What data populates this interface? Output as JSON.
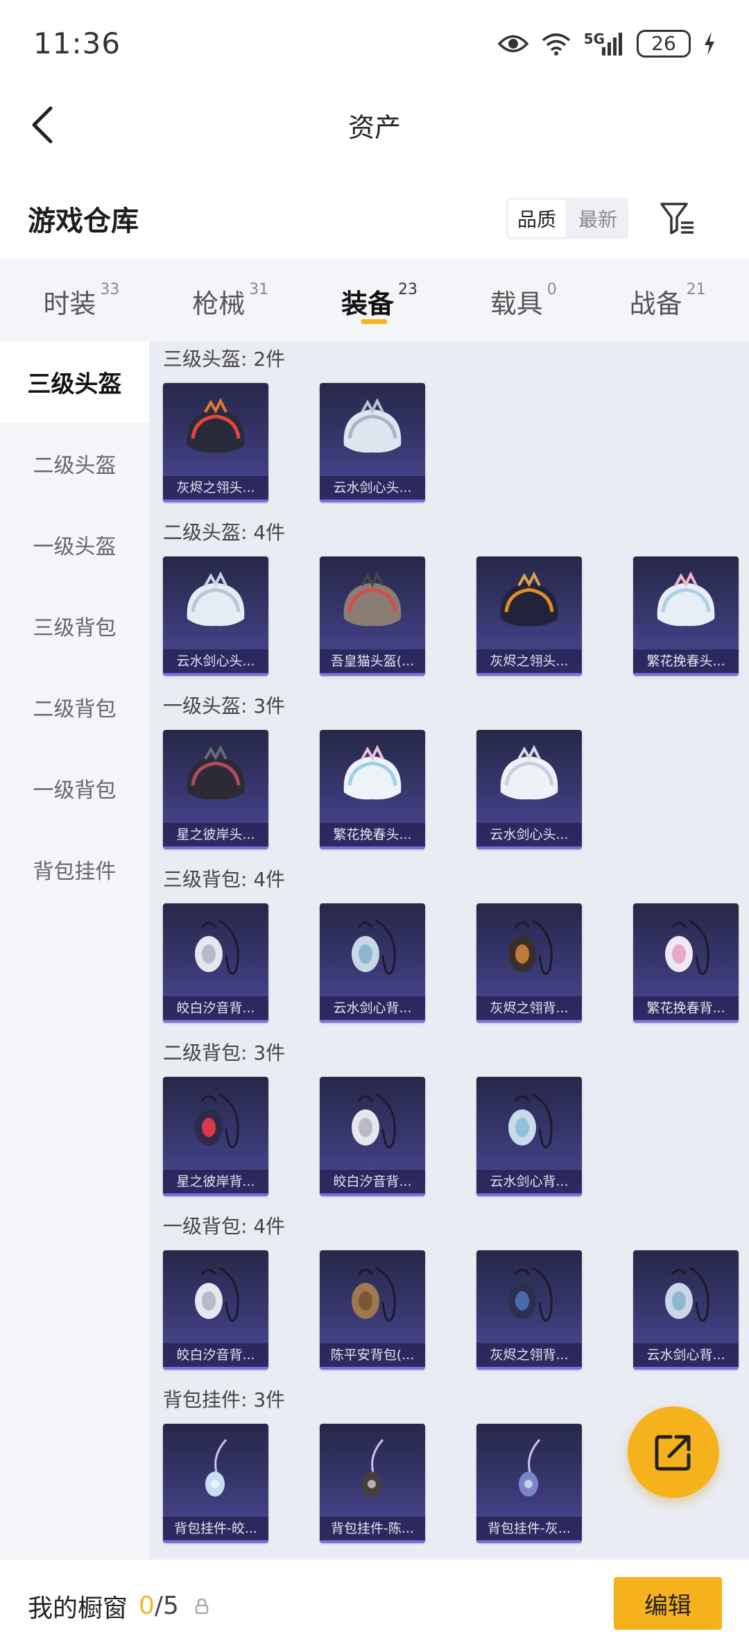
{
  "status_bar": {
    "time": "11:36",
    "network_label": "5G",
    "battery": "26",
    "icons": [
      "eye-icon",
      "wifi-icon",
      "signal-icon",
      "battery-icon",
      "charging-icon"
    ]
  },
  "header": {
    "title": "资产",
    "back_icon": "chevron-left-icon"
  },
  "warehouse": {
    "title": "游戏仓库",
    "sort_options": [
      "品质",
      "最新"
    ],
    "sort_selected": "品质",
    "filter_icon": "filter-icon"
  },
  "tabs": [
    {
      "label": "时装",
      "count": "33",
      "active": false
    },
    {
      "label": "枪械",
      "count": "31",
      "active": false
    },
    {
      "label": "装备",
      "count": "23",
      "active": true
    },
    {
      "label": "载具",
      "count": "0",
      "active": false
    },
    {
      "label": "战备",
      "count": "21",
      "active": false
    }
  ],
  "sidebar": {
    "items": [
      {
        "label": "三级头盔",
        "active": true
      },
      {
        "label": "二级头盔",
        "active": false
      },
      {
        "label": "一级头盔",
        "active": false
      },
      {
        "label": "三级背包",
        "active": false
      },
      {
        "label": "二级背包",
        "active": false
      },
      {
        "label": "一级背包",
        "active": false
      },
      {
        "label": "背包挂件",
        "active": false
      }
    ]
  },
  "sections": [
    {
      "title": "三级头盔: 2件",
      "items": [
        "灰烬之翎头...",
        "云水剑心头..."
      ]
    },
    {
      "title": "二级头盔: 4件",
      "items": [
        "云水剑心头...",
        "吾皇猫头盔(...",
        "灰烬之翎头...",
        "繁花挽春头..."
      ]
    },
    {
      "title": "一级头盔: 3件",
      "items": [
        "星之彼岸头...",
        "繁花挽春头...",
        "云水剑心头..."
      ]
    },
    {
      "title": "三级背包: 4件",
      "items": [
        "皎白汐音背...",
        "云水剑心背...",
        "灰烬之翎背...",
        "繁花挽春背..."
      ]
    },
    {
      "title": "二级背包: 3件",
      "items": [
        "星之彼岸背...",
        "皎白汐音背...",
        "云水剑心背..."
      ]
    },
    {
      "title": "一级背包: 4件",
      "items": [
        "皎白汐音背...",
        "陈平安背包(...",
        "灰烬之翎背...",
        "云水剑心背..."
      ]
    },
    {
      "title": "背包挂件: 3件",
      "items": [
        "背包挂件-皎...",
        "背包挂件-陈...",
        "背包挂件-灰..."
      ]
    }
  ],
  "fab": {
    "icon": "share-icon"
  },
  "bottom_bar": {
    "label": "我的橱窗",
    "count_current": "0",
    "count_total": "/5",
    "lock_icon": "lock-icon",
    "edit_label": "编辑"
  },
  "colors": {
    "accent": "#f6b21c",
    "card_top": "#262848",
    "card_bottom": "#4d4a9a",
    "panel_bg": "#e9ecf3"
  }
}
